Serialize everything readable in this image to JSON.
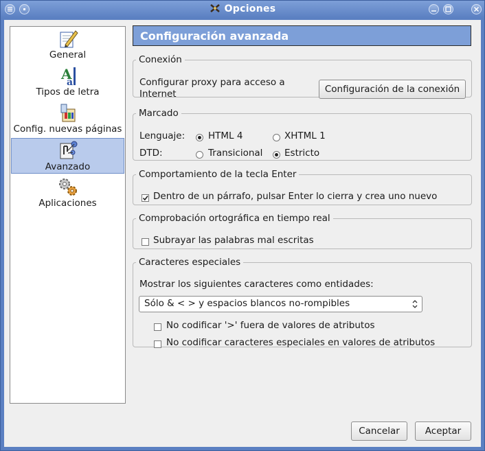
{
  "window": {
    "title": "Opciones"
  },
  "sidebar": {
    "items": [
      {
        "label": "General",
        "icon": "pencil-icon"
      },
      {
        "label": "Tipos de letra",
        "icon": "font-icon"
      },
      {
        "label": "Config. nuevas páginas",
        "icon": "new-page-icon"
      },
      {
        "label": "Avanzado",
        "icon": "advanced-icon",
        "selected": true
      },
      {
        "label": "Aplicaciones",
        "icon": "gears-icon"
      }
    ]
  },
  "header": {
    "title": "Configuración avanzada"
  },
  "conexion": {
    "legend": "Conexión",
    "text_line1": "Configurar proxy para acceso a",
    "text_line2": "Internet",
    "button_label": "Configuración de la conexión"
  },
  "marcado": {
    "legend": "Marcado",
    "lenguaje_label": "Lenguaje:",
    "lenguaje_options": [
      "HTML 4",
      "XHTML 1"
    ],
    "lenguaje_selected": "HTML 4",
    "dtd_label": "DTD:",
    "dtd_options": [
      "Transicional",
      "Estricto"
    ],
    "dtd_selected": "Estricto"
  },
  "enter": {
    "legend": "Comportamiento de la tecla Enter",
    "checkbox_label": "Dentro de un párrafo, pulsar Enter lo cierra y crea uno nuevo",
    "checked": true
  },
  "ortografia": {
    "legend": "Comprobación ortográfica en tiempo real",
    "checkbox_label": "Subrayar las palabras mal escritas",
    "checked": false
  },
  "especiales": {
    "legend": "Caracteres especiales",
    "prompt": "Mostrar los siguientes caracteres como entidades:",
    "select_value": "Sólo & < > y espacios blancos no-rompibles",
    "checkbox1_label": "No codificar '>' fuera de valores de atributos",
    "checkbox1_checked": false,
    "checkbox2_label": "No codificar caracteres especiales en valores de atributos",
    "checkbox2_checked": false
  },
  "footer": {
    "cancel_label": "Cancelar",
    "accept_label": "Aceptar"
  }
}
